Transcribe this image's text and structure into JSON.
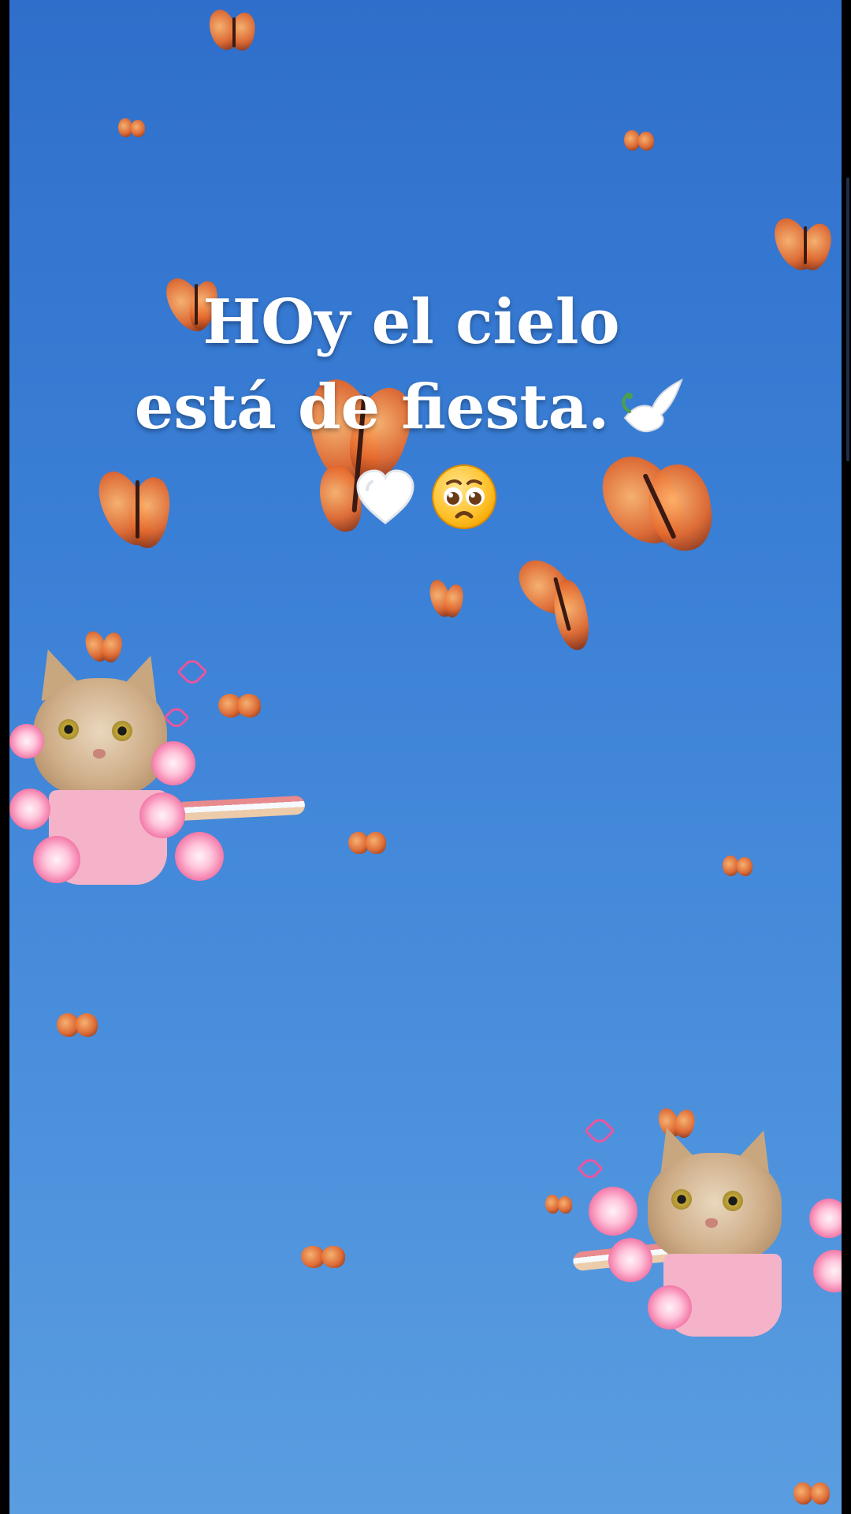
{
  "post": {
    "message_line1": "HOy el cielo",
    "message_line2": "está de fiesta.",
    "trailing_emojis": [
      "dove-emoji",
      "white-heart-emoji",
      "pleading-face-emoji"
    ]
  },
  "stickers": [
    {
      "name": "cat-sticker-left",
      "description_icon": "cat-with-flowers-icon"
    },
    {
      "name": "cat-sticker-right",
      "description_icon": "cat-with-flowers-icon"
    }
  ],
  "background": {
    "sky_color_top": "#2f6fcb",
    "sky_color_bottom": "#5a9de0",
    "butterfly_color": "#e56a2e"
  }
}
